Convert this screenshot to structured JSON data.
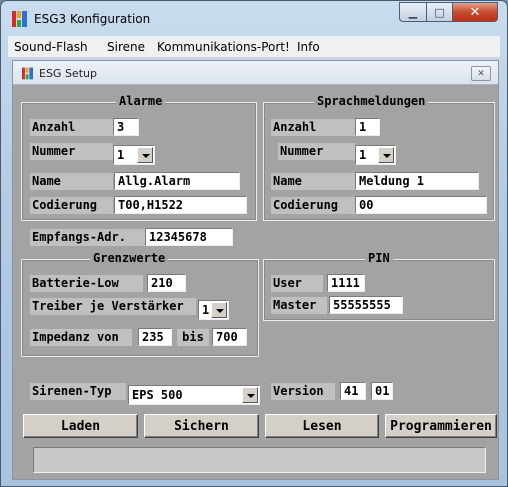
{
  "window": {
    "title": "ESG3 Konfiguration",
    "minimize_glyph": "▁",
    "maximize_glyph": "□",
    "close_glyph": "✕"
  },
  "menu": {
    "items": [
      {
        "label": "Sound-Flash"
      },
      {
        "label": "Sirene"
      },
      {
        "label": "Kommunikations-Port!"
      },
      {
        "label": "Info"
      }
    ]
  },
  "child": {
    "title": "ESG Setup",
    "close_glyph": "✕"
  },
  "alarme": {
    "legend": "Alarme",
    "anzahl_label": "Anzahl",
    "anzahl_value": "3",
    "nummer_label": "Nummer",
    "nummer_value": "1",
    "name_label": "Name",
    "name_value": "Allg.Alarm",
    "codierung_label": "Codierung",
    "codierung_value": "T00,H1522"
  },
  "sprach": {
    "legend": "Sprachmeldungen",
    "anzahl_label": "Anzahl",
    "anzahl_value": "1",
    "nummer_label": "Nummer",
    "nummer_value": "1",
    "name_label": "Name",
    "name_value": "Meldung 1",
    "codierung_label": "Codierung",
    "codierung_value": "00"
  },
  "empfang": {
    "label": "Empfangs-Adr.",
    "value": "12345678"
  },
  "grenzwerte": {
    "legend": "Grenzwerte",
    "batterie_label": "Batterie-Low",
    "batterie_value": "210",
    "treiber_label": "Treiber je Verstärker",
    "treiber_value": "1",
    "impedanz_label": "Impedanz von",
    "impedanz_from": "235",
    "bis_label": "bis",
    "impedanz_to": "700"
  },
  "pin": {
    "legend": "PIN",
    "user_label": "User",
    "user_value": "1111",
    "master_label": "Master",
    "master_value": "55555555"
  },
  "sirene": {
    "label": "Sirenen-Typ",
    "value": "EPS 500",
    "version_label": "Version",
    "version_major": "41",
    "version_minor": "01"
  },
  "buttons": {
    "laden": "Laden",
    "sichern": "Sichern",
    "lesen": "Lesen",
    "programmieren": "Programmieren"
  },
  "status": ""
}
